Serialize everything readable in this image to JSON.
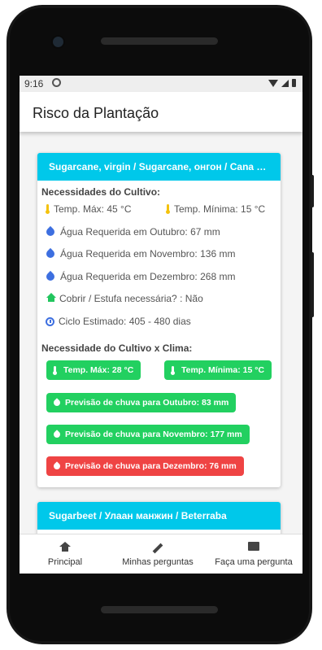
{
  "status_bar": {
    "time": "9:16"
  },
  "app_bar": {
    "title": "Risco da Plantação"
  },
  "cards": [
    {
      "header": "Sugarcane, virgin / Sugarcane, онгон / Cana de ac...",
      "needs_title": "Necessidades do Cultivo:",
      "temp_max": "Temp. Máx: 45 °C",
      "temp_min": "Temp. Mínima: 15 °C",
      "water_oct": "Água Requerida em Outubro: 67 mm",
      "water_nov": "Água Requerida em Novembro: 136 mm",
      "water_dec": "Água Requerida em Dezembro: 268 mm",
      "cover": "Cobrir / Estufa necessária? : Não",
      "cycle": "Ciclo Estimado: 405 - 480 dias",
      "climate_title": "Necessidade do Cultivo x Clima:",
      "badge_temp_max": "Temp. Máx: 28 °C",
      "badge_temp_min": "Temp. Mínima: 15 °C",
      "badge_rain_oct": "Previsão de chuva para Outubro: 83 mm",
      "badge_rain_nov": "Previsão de chuva para Novembro: 177 mm",
      "badge_rain_dec": "Previsão de chuva para Dezembro: 76 mm"
    },
    {
      "header": "Sugarbeet / Улаан манжин / Beterraba"
    }
  ],
  "colors": {
    "accent": "#00c8ea",
    "ok": "#22d060",
    "alert": "#ef4444",
    "drop": "#3d6fe0",
    "thermo": "#f4c20d"
  },
  "bottom_nav": [
    {
      "label": "Principal",
      "icon": "home-icon"
    },
    {
      "label": "Minhas perguntas",
      "icon": "pencil-icon"
    },
    {
      "label": "Faça uma pergunta",
      "icon": "chat-icon"
    }
  ]
}
